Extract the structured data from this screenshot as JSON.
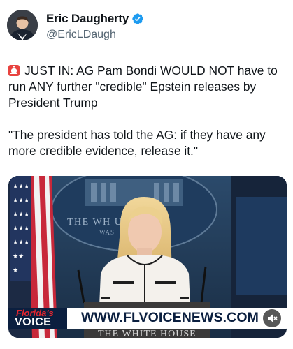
{
  "author": {
    "display_name": "Eric Daugherty",
    "handle": "@EricLDaugh",
    "verified_icon": "verified-badge-icon",
    "badge_color": "#1d9bf0"
  },
  "tweet": {
    "line1_icon": "siren-icon",
    "text1": "JUST IN: AG Pam Bondi WOULD NOT have to run ANY further \"credible\" Epstein releases by President Trump",
    "text2": "\"The president has told the AG: if they have any more credible evidence, release it.\""
  },
  "media": {
    "type": "video",
    "backdrop_text_top": "THE WH          USE",
    "backdrop_text_sub": "WAS",
    "podium_text": "THE WHITE HOUSE",
    "banner_brand_line1": "Florida's",
    "banner_brand_line2": "VOICE",
    "banner_url": "WWW.FLVOICENEWS.COM",
    "mute_icon": "speaker-muted-icon"
  },
  "colors": {
    "text_primary": "#0f1419",
    "text_secondary": "#536471",
    "banner_navy": "#0b1f3f",
    "brand_red": "#e2262f"
  }
}
